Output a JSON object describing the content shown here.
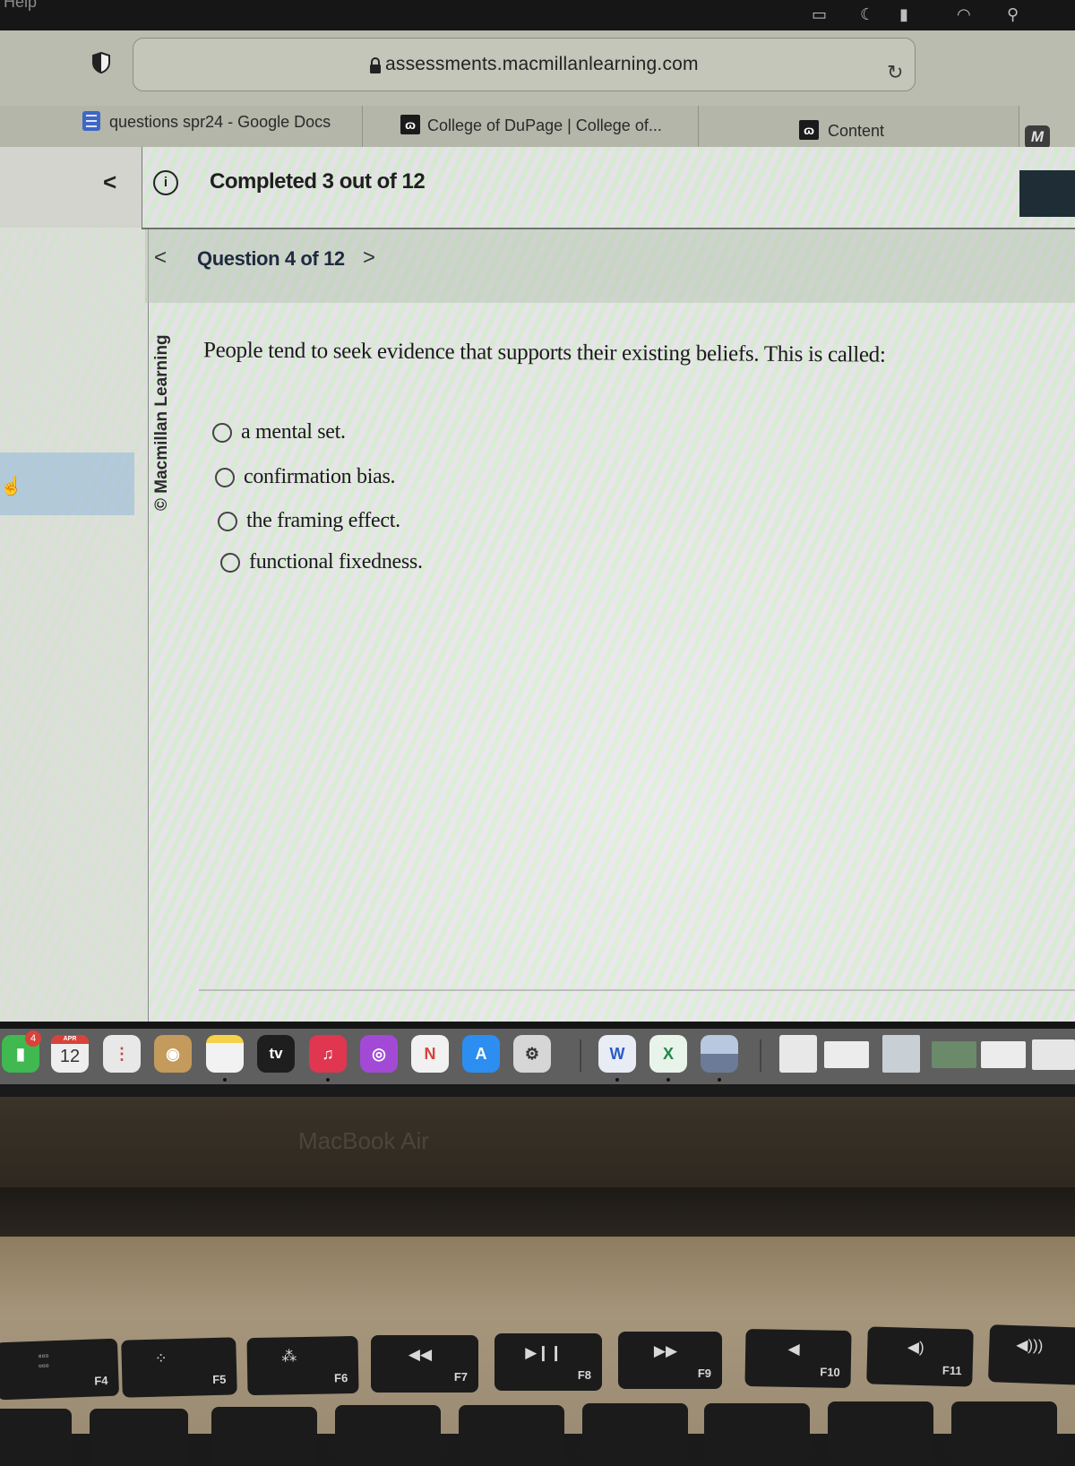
{
  "menubar": {
    "partial_menu": "Help",
    "status_icons": [
      "window-icon",
      "do-not-disturb-icon",
      "battery-icon",
      "wifi-icon",
      "spotlight-search-icon"
    ]
  },
  "browser": {
    "url": "assessments.macmillanlearning.com",
    "tabs": [
      {
        "label": "questions spr24 - Google Docs",
        "icon": "google-docs-icon"
      },
      {
        "label": "College of DuPage | College of...",
        "icon": "college-of-dupage-icon"
      },
      {
        "label": "Content",
        "icon": "college-of-dupage-icon"
      }
    ],
    "extension_label": "M"
  },
  "assessment": {
    "progress_text": "Completed 3 out of 12",
    "progress": {
      "completed": 3,
      "total": 12
    },
    "question_counter": "Question 4 of 12",
    "current_question": 4,
    "copyright": "© Macmillan Learning",
    "question": "People tend to seek evidence that supports their existing beliefs. This is called:",
    "choices": [
      {
        "label": "a mental set.",
        "selected": false
      },
      {
        "label": "confirmation bias.",
        "selected": false
      },
      {
        "label": "the framing effect.",
        "selected": false
      },
      {
        "label": "functional fixedness.",
        "selected": false
      }
    ]
  },
  "dock": {
    "apps": [
      {
        "name": "FaceTime",
        "badge": "4"
      },
      {
        "name": "Calendar",
        "month": "APR",
        "day": "12"
      },
      {
        "name": "Reminders"
      },
      {
        "name": "Contacts"
      },
      {
        "name": "Notes"
      },
      {
        "name": "Apple TV",
        "label": "tv"
      },
      {
        "name": "Music"
      },
      {
        "name": "Podcasts"
      },
      {
        "name": "News"
      },
      {
        "name": "App Store"
      },
      {
        "name": "System Settings"
      },
      {
        "name": "Microsoft Word",
        "label": "W"
      },
      {
        "name": "Microsoft Excel",
        "label": "X"
      },
      {
        "name": "Preview"
      }
    ]
  },
  "laptop": {
    "model_label": "MacBook Air",
    "function_keys": [
      "F4",
      "F5",
      "F6",
      "F7",
      "F8",
      "F9",
      "F10",
      "F11"
    ]
  },
  "colors": {
    "menubar": "#161616",
    "chrome": "#b9bcae",
    "dock": "#5f5f5f",
    "badge": "#d9423a",
    "word": "#2b5cc8",
    "excel": "#1f8a48",
    "music": "#e0364f",
    "podcasts": "#a24ad6",
    "appstore": "#2c8ef0"
  }
}
